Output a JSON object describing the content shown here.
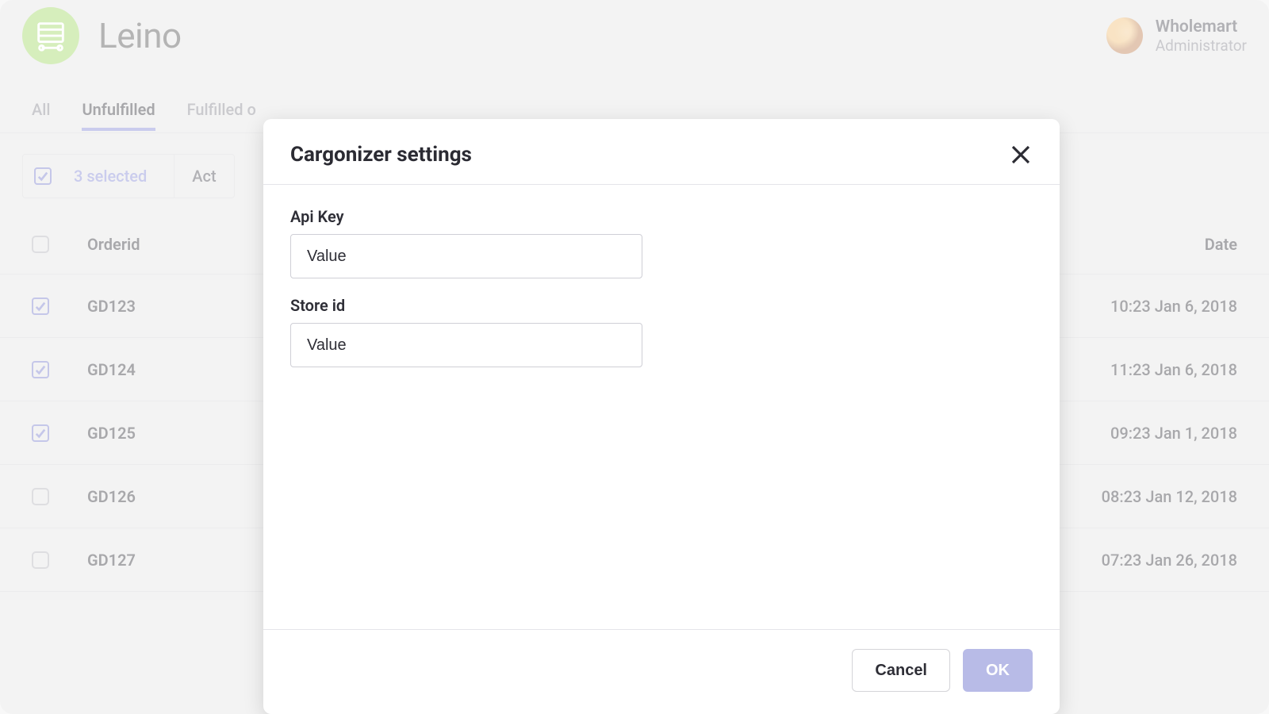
{
  "header": {
    "brand": "Leino",
    "user_name": "Wholemart",
    "user_role": "Administrator"
  },
  "tabs": [
    {
      "label": "All",
      "active": false
    },
    {
      "label": "Unfulfilled",
      "active": true
    },
    {
      "label": "Fulfilled o",
      "active": false
    }
  ],
  "toolbar": {
    "selected_label": "3 selected",
    "actions_label": "Act"
  },
  "table": {
    "headers": {
      "orderid": "Orderid",
      "date": "Date"
    },
    "rows": [
      {
        "checked": true,
        "orderid": "GD123",
        "date": "10:23 Jan 6, 2018"
      },
      {
        "checked": true,
        "orderid": "GD124",
        "date": "11:23 Jan 6, 2018"
      },
      {
        "checked": true,
        "orderid": "GD125",
        "date": "09:23 Jan 1, 2018"
      },
      {
        "checked": false,
        "orderid": "GD126",
        "date": "08:23 Jan 12, 2018"
      },
      {
        "checked": false,
        "orderid": "GD127",
        "date": "07:23 Jan 26, 2018"
      }
    ]
  },
  "modal": {
    "title": "Cargonizer settings",
    "fields": {
      "api_key": {
        "label": "Api Key",
        "placeholder": "Value"
      },
      "store_id": {
        "label": "Store id",
        "placeholder": "Value"
      }
    },
    "buttons": {
      "cancel": "Cancel",
      "ok": "OK"
    }
  }
}
